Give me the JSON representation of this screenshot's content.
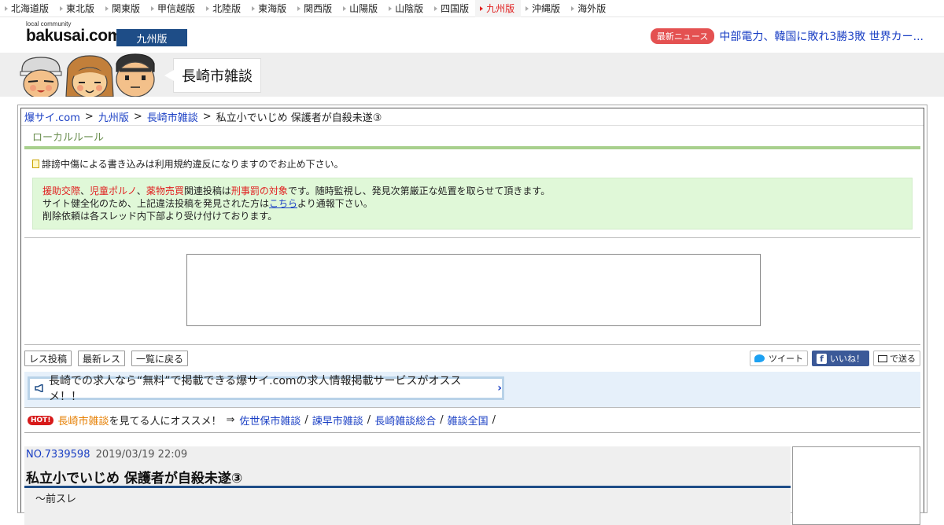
{
  "regions": [
    {
      "label": "北海道版",
      "active": false
    },
    {
      "label": "東北版",
      "active": false
    },
    {
      "label": "関東版",
      "active": false
    },
    {
      "label": "甲信越版",
      "active": false
    },
    {
      "label": "北陸版",
      "active": false
    },
    {
      "label": "東海版",
      "active": false
    },
    {
      "label": "関西版",
      "active": false
    },
    {
      "label": "山陽版",
      "active": false
    },
    {
      "label": "山陰版",
      "active": false
    },
    {
      "label": "四国版",
      "active": false
    },
    {
      "label": "九州版",
      "active": true
    },
    {
      "label": "沖縄版",
      "active": false
    },
    {
      "label": "海外版",
      "active": false
    }
  ],
  "header": {
    "logo_small": "local community",
    "logo_main": "bakusai.com",
    "edition": "九州版",
    "news_badge": "最新ニュース",
    "news_text": "中部電力、韓国に敗れ3勝3敗 世界カー..."
  },
  "banner": {
    "board_name": "長崎市雑談"
  },
  "breadcrumb": {
    "items": [
      "爆サイ.com",
      "九州版",
      "長崎市雑談"
    ],
    "separator": ">",
    "current": "私立小でいじめ 保護者が自殺未遂③"
  },
  "local_rule": {
    "title": "ローカルルール",
    "warning": "誹謗中傷による書き込みは利用規約違反になりますのでお止め下さい。",
    "red1": "援助交際",
    "sep1": "、",
    "red2": "児童ポルノ",
    "sep2": "、",
    "red3": "薬物売買",
    "text1": "関連投稿は",
    "red4": "刑事罰の対象",
    "text2": "です。随時監視し、発見次第厳正な処置を取らせて頂きます。",
    "line2_a": "サイト健全化のため、上記違法投稿を発見された方は",
    "line2_link": "こちら",
    "line2_b": "より通報下さい。",
    "line3": "削除依頼は各スレッド内下部より受け付けております。"
  },
  "actions": {
    "post": "レス投稿",
    "latest": "最新レス",
    "back": "一覧に戻る",
    "tweet": "ツイート",
    "like": "いいね！",
    "send": "で送る"
  },
  "promo": {
    "text": "長崎での求人なら“無料”で掲載できる爆サイ.comの求人情報掲載サービスがオススメ！！"
  },
  "recommend": {
    "hot": "HOT!",
    "board": "長崎市雑談",
    "text": "を見てる人にオススメ！",
    "arrow": "⇒",
    "links": [
      "佐世保市雑談",
      "諫早市雑談",
      "長崎雑談総合",
      "雑談全国"
    ],
    "slash": "/"
  },
  "thread": {
    "no": "NO.7339598",
    "date": "2019/03/19 22:09",
    "title": "私立小でいじめ 保護者が自殺未遂③",
    "partial": "～前スレ"
  }
}
